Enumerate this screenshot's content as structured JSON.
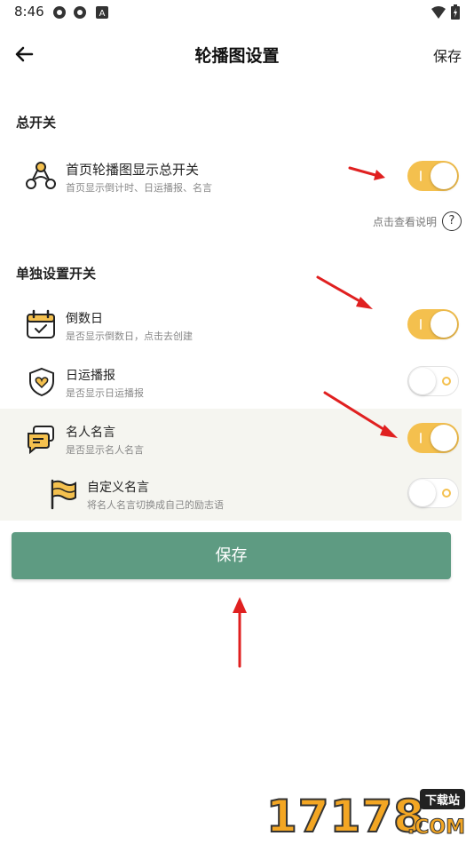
{
  "status_bar": {
    "time": "8:46",
    "icons": [
      "settings-icon",
      "settings-icon",
      "a-icon",
      "wifi-icon",
      "battery-icon"
    ]
  },
  "header": {
    "title": "轮播图设置",
    "save_label": "保存"
  },
  "sections": {
    "master_title": "总开关",
    "individual_title": "单独设置开关"
  },
  "master": {
    "title": "首页轮播图显示总开关",
    "subtitle": "首页显示倒计时、日运播报、名言",
    "enabled": true,
    "help_text": "点击查看说明",
    "help_icon": "?"
  },
  "items": [
    {
      "title": "倒数日",
      "subtitle": "是否显示倒数日，点击去创建",
      "enabled": true,
      "icon": "calendar-icon"
    },
    {
      "title": "日运播报",
      "subtitle": "是否显示日运播报",
      "enabled": false,
      "icon": "heart-shield-icon"
    },
    {
      "title": "名人名言",
      "subtitle": "是否显示名人名言",
      "enabled": true,
      "icon": "chat-bubble-icon"
    },
    {
      "title": "自定义名言",
      "subtitle": "将名人名言切换成自己的励志语",
      "enabled": false,
      "icon": "flag-icon"
    }
  ],
  "save_button": {
    "label": "保存"
  },
  "watermark": {
    "number": "17178",
    "badge": "下载站",
    "domain": ".COM"
  },
  "colors": {
    "accent": "#f4c04e",
    "primary": "#5e9b82",
    "arrow": "#e02020"
  }
}
